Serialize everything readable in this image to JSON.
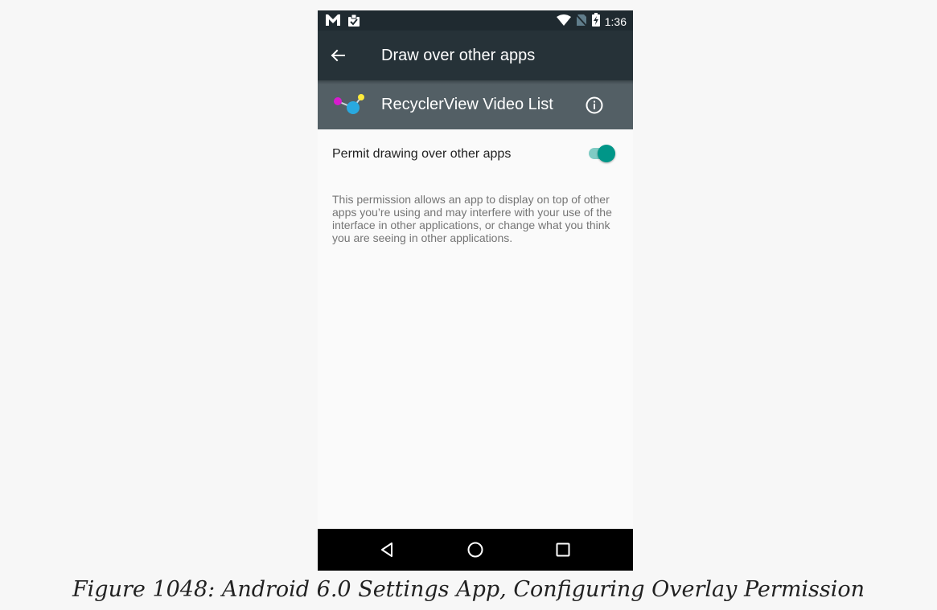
{
  "status_bar": {
    "time": "1:36",
    "icons_left": [
      "gmail-icon",
      "clipboard-check-icon"
    ],
    "icons_right": [
      "wifi-icon",
      "no-sim-icon",
      "battery-charging-icon"
    ]
  },
  "app_bar": {
    "title": "Draw over other apps",
    "back_icon": "arrow-back-icon"
  },
  "app_header": {
    "app_name": "RecyclerView Video List",
    "info_icon": "info-icon"
  },
  "setting": {
    "label": "Permit drawing over other apps",
    "enabled": true,
    "accent_color": "#009688"
  },
  "description": "This permission allows an app to display on top of other apps you’re using and may interfere with your use of the interface in other applications, or change what you think you are seeing in other applications.",
  "nav_bar": {
    "buttons": [
      "back-triangle-icon",
      "home-circle-icon",
      "recents-square-icon"
    ]
  },
  "caption": "Figure 1048: Android 6.0 Settings App, Configuring Overlay Permission"
}
